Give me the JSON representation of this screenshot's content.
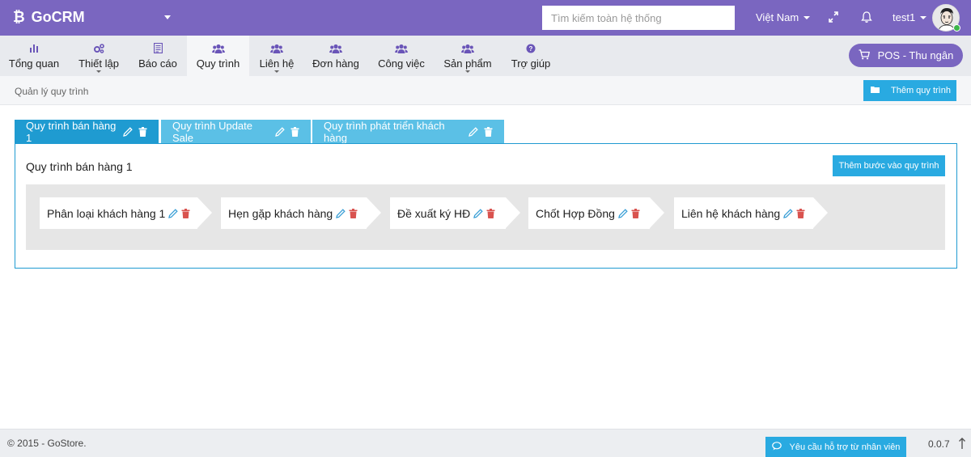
{
  "brand": {
    "name": "GoCRM",
    "logo_icon": "bitcoin-icon"
  },
  "header": {
    "search_placeholder": "Tìm kiếm toàn hệ thống",
    "language": "Việt Nam",
    "username": "test1",
    "accent_color": "#7a66c0"
  },
  "nav": {
    "items": [
      {
        "label": "Tổng quan",
        "icon": "bar-chart-icon"
      },
      {
        "label": "Thiết lập",
        "icon": "gears-icon"
      },
      {
        "label": "Báo cáo",
        "icon": "report-icon"
      },
      {
        "label": "Quy trình",
        "icon": "users-icon"
      },
      {
        "label": "Liên hệ",
        "icon": "users-icon"
      },
      {
        "label": "Đơn hàng",
        "icon": "users-icon"
      },
      {
        "label": "Công việc",
        "icon": "users-icon"
      },
      {
        "label": "Sản phẩm",
        "icon": "users-icon"
      },
      {
        "label": "Trợ giúp",
        "icon": "question-icon"
      }
    ],
    "active": "Quy trình",
    "pos_label": "POS - Thu ngân"
  },
  "breadcrumb": {
    "label": "Quản lý quy trình"
  },
  "add_process_label": "Thêm quy trình",
  "tabs": [
    {
      "label": "Quy trình bán hàng 1"
    },
    {
      "label": "Quy trình Update Sale"
    },
    {
      "label": "Quy trình phát triển khách hàng"
    }
  ],
  "panel": {
    "title": "Quy trình bán hàng 1",
    "add_step_label": "Thêm bước vào quy trình",
    "steps": [
      {
        "label": "Phân loại khách hàng 1"
      },
      {
        "label": "Hẹn gặp khách hàng"
      },
      {
        "label": "Đề xuất ký HĐ"
      },
      {
        "label": "Chốt Hợp Đồng"
      },
      {
        "label": "Liên hệ khách hàng"
      }
    ]
  },
  "footer": {
    "copyright": "© 2015 - GoStore.",
    "support_label": "Yêu cầu hỗ trợ từ nhân viên",
    "version": "0.0.7"
  },
  "colors": {
    "tab_active": "#1f9bd1",
    "tab_inactive": "#5bc0e6",
    "button": "#29aae1",
    "delete": "#d9534f"
  }
}
